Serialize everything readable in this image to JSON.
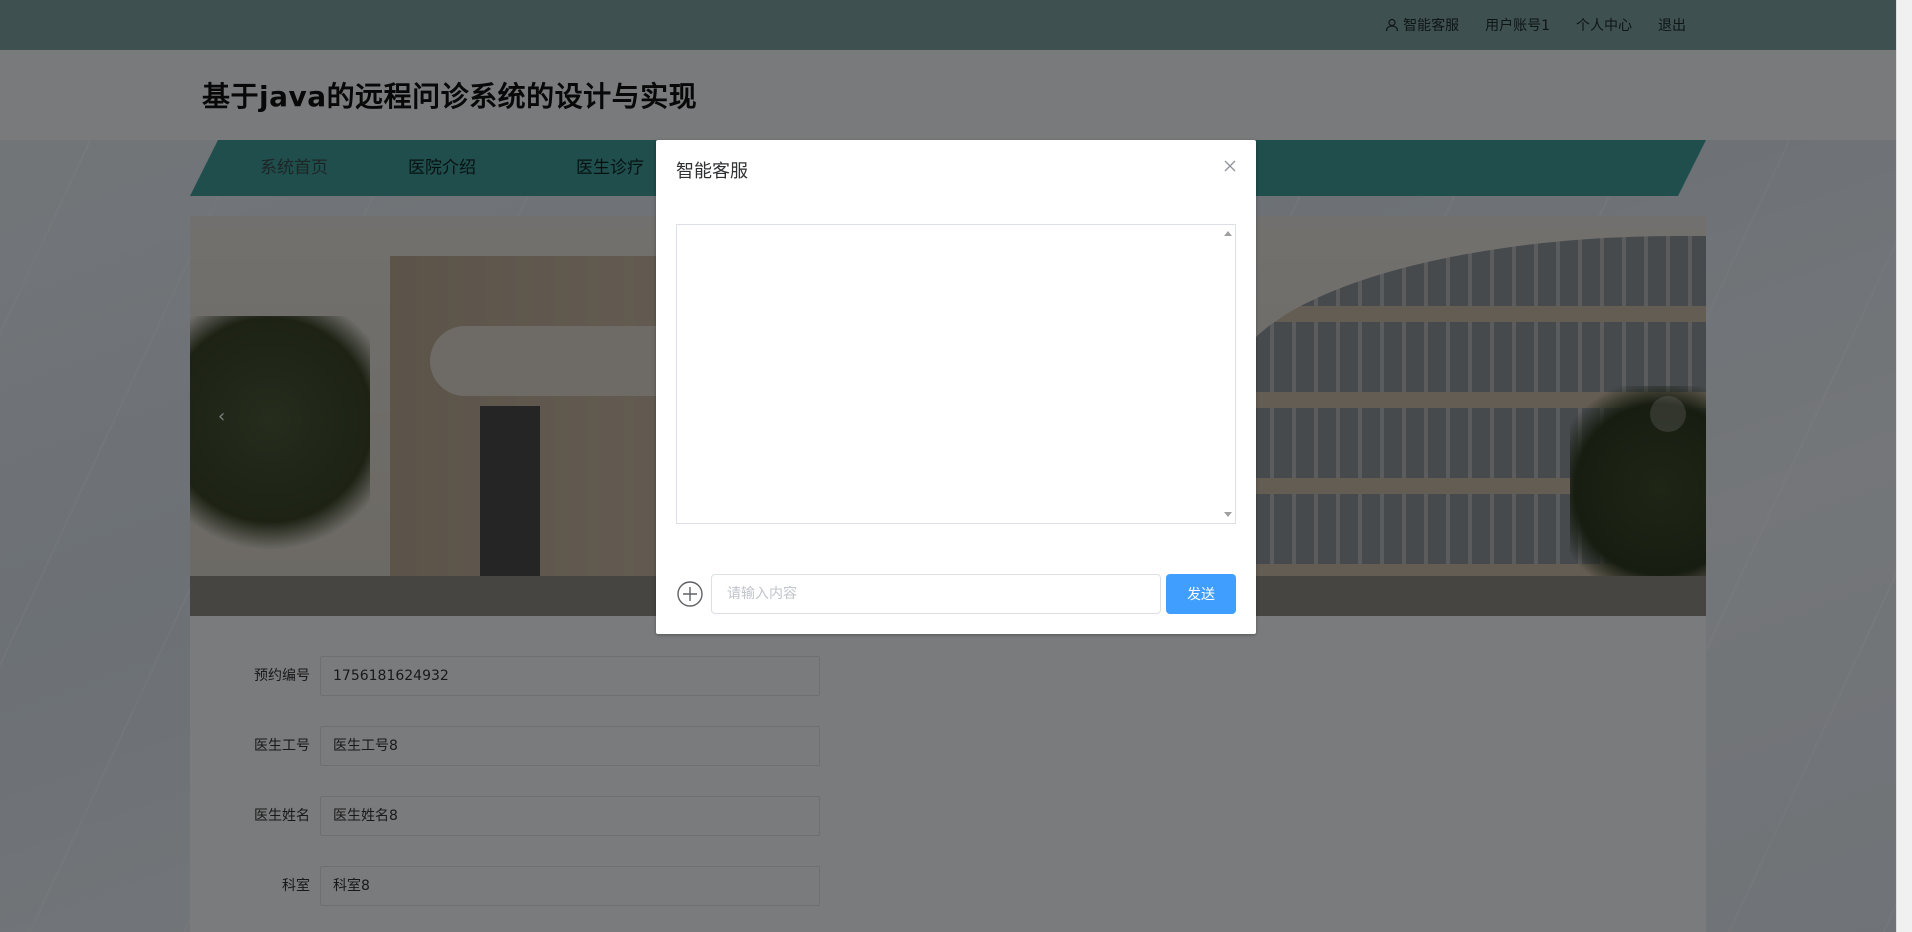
{
  "topbar": {
    "links": [
      {
        "label": "智能客服",
        "icon": "user-icon"
      },
      {
        "label": "用户账号1"
      },
      {
        "label": "个人中心"
      },
      {
        "label": "退出"
      }
    ]
  },
  "header": {
    "title": "基于java的远程问诊系统的设计与实现"
  },
  "nav": {
    "items": [
      {
        "label": "系统首页"
      },
      {
        "label": "医院介绍"
      },
      {
        "label": "医生诊疗"
      }
    ]
  },
  "banner": {
    "prev_arrow": "‹"
  },
  "form": {
    "fields": [
      {
        "label": "预约编号",
        "value": "1756181624932"
      },
      {
        "label": "医生工号",
        "value": "医生工号8"
      },
      {
        "label": "医生姓名",
        "value": "医生姓名8"
      },
      {
        "label": "科室",
        "value": "科室8"
      }
    ]
  },
  "dialog": {
    "title": "智能客服",
    "input_placeholder": "请输入内容",
    "send_label": "发送"
  },
  "colors": {
    "topbar": "#7ea1a0",
    "nav": "#3f9c9a",
    "primary_button": "#409eff"
  }
}
